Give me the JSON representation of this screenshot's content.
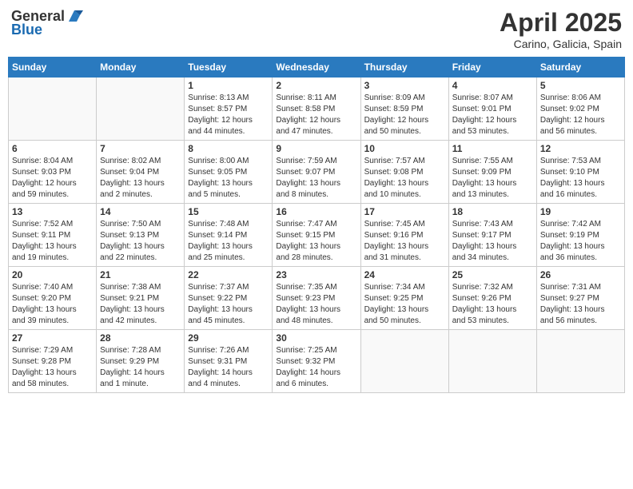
{
  "header": {
    "logo": {
      "general": "General",
      "blue": "Blue"
    },
    "title": "April 2025",
    "location": "Carino, Galicia, Spain"
  },
  "weekdays": [
    "Sunday",
    "Monday",
    "Tuesday",
    "Wednesday",
    "Thursday",
    "Friday",
    "Saturday"
  ],
  "weeks": [
    [
      {
        "day": "",
        "text": ""
      },
      {
        "day": "",
        "text": ""
      },
      {
        "day": "1",
        "text": "Sunrise: 8:13 AM\nSunset: 8:57 PM\nDaylight: 12 hours\nand 44 minutes."
      },
      {
        "day": "2",
        "text": "Sunrise: 8:11 AM\nSunset: 8:58 PM\nDaylight: 12 hours\nand 47 minutes."
      },
      {
        "day": "3",
        "text": "Sunrise: 8:09 AM\nSunset: 8:59 PM\nDaylight: 12 hours\nand 50 minutes."
      },
      {
        "day": "4",
        "text": "Sunrise: 8:07 AM\nSunset: 9:01 PM\nDaylight: 12 hours\nand 53 minutes."
      },
      {
        "day": "5",
        "text": "Sunrise: 8:06 AM\nSunset: 9:02 PM\nDaylight: 12 hours\nand 56 minutes."
      }
    ],
    [
      {
        "day": "6",
        "text": "Sunrise: 8:04 AM\nSunset: 9:03 PM\nDaylight: 12 hours\nand 59 minutes."
      },
      {
        "day": "7",
        "text": "Sunrise: 8:02 AM\nSunset: 9:04 PM\nDaylight: 13 hours\nand 2 minutes."
      },
      {
        "day": "8",
        "text": "Sunrise: 8:00 AM\nSunset: 9:05 PM\nDaylight: 13 hours\nand 5 minutes."
      },
      {
        "day": "9",
        "text": "Sunrise: 7:59 AM\nSunset: 9:07 PM\nDaylight: 13 hours\nand 8 minutes."
      },
      {
        "day": "10",
        "text": "Sunrise: 7:57 AM\nSunset: 9:08 PM\nDaylight: 13 hours\nand 10 minutes."
      },
      {
        "day": "11",
        "text": "Sunrise: 7:55 AM\nSunset: 9:09 PM\nDaylight: 13 hours\nand 13 minutes."
      },
      {
        "day": "12",
        "text": "Sunrise: 7:53 AM\nSunset: 9:10 PM\nDaylight: 13 hours\nand 16 minutes."
      }
    ],
    [
      {
        "day": "13",
        "text": "Sunrise: 7:52 AM\nSunset: 9:11 PM\nDaylight: 13 hours\nand 19 minutes."
      },
      {
        "day": "14",
        "text": "Sunrise: 7:50 AM\nSunset: 9:13 PM\nDaylight: 13 hours\nand 22 minutes."
      },
      {
        "day": "15",
        "text": "Sunrise: 7:48 AM\nSunset: 9:14 PM\nDaylight: 13 hours\nand 25 minutes."
      },
      {
        "day": "16",
        "text": "Sunrise: 7:47 AM\nSunset: 9:15 PM\nDaylight: 13 hours\nand 28 minutes."
      },
      {
        "day": "17",
        "text": "Sunrise: 7:45 AM\nSunset: 9:16 PM\nDaylight: 13 hours\nand 31 minutes."
      },
      {
        "day": "18",
        "text": "Sunrise: 7:43 AM\nSunset: 9:17 PM\nDaylight: 13 hours\nand 34 minutes."
      },
      {
        "day": "19",
        "text": "Sunrise: 7:42 AM\nSunset: 9:19 PM\nDaylight: 13 hours\nand 36 minutes."
      }
    ],
    [
      {
        "day": "20",
        "text": "Sunrise: 7:40 AM\nSunset: 9:20 PM\nDaylight: 13 hours\nand 39 minutes."
      },
      {
        "day": "21",
        "text": "Sunrise: 7:38 AM\nSunset: 9:21 PM\nDaylight: 13 hours\nand 42 minutes."
      },
      {
        "day": "22",
        "text": "Sunrise: 7:37 AM\nSunset: 9:22 PM\nDaylight: 13 hours\nand 45 minutes."
      },
      {
        "day": "23",
        "text": "Sunrise: 7:35 AM\nSunset: 9:23 PM\nDaylight: 13 hours\nand 48 minutes."
      },
      {
        "day": "24",
        "text": "Sunrise: 7:34 AM\nSunset: 9:25 PM\nDaylight: 13 hours\nand 50 minutes."
      },
      {
        "day": "25",
        "text": "Sunrise: 7:32 AM\nSunset: 9:26 PM\nDaylight: 13 hours\nand 53 minutes."
      },
      {
        "day": "26",
        "text": "Sunrise: 7:31 AM\nSunset: 9:27 PM\nDaylight: 13 hours\nand 56 minutes."
      }
    ],
    [
      {
        "day": "27",
        "text": "Sunrise: 7:29 AM\nSunset: 9:28 PM\nDaylight: 13 hours\nand 58 minutes."
      },
      {
        "day": "28",
        "text": "Sunrise: 7:28 AM\nSunset: 9:29 PM\nDaylight: 14 hours\nand 1 minute."
      },
      {
        "day": "29",
        "text": "Sunrise: 7:26 AM\nSunset: 9:31 PM\nDaylight: 14 hours\nand 4 minutes."
      },
      {
        "day": "30",
        "text": "Sunrise: 7:25 AM\nSunset: 9:32 PM\nDaylight: 14 hours\nand 6 minutes."
      },
      {
        "day": "",
        "text": ""
      },
      {
        "day": "",
        "text": ""
      },
      {
        "day": "",
        "text": ""
      }
    ]
  ]
}
